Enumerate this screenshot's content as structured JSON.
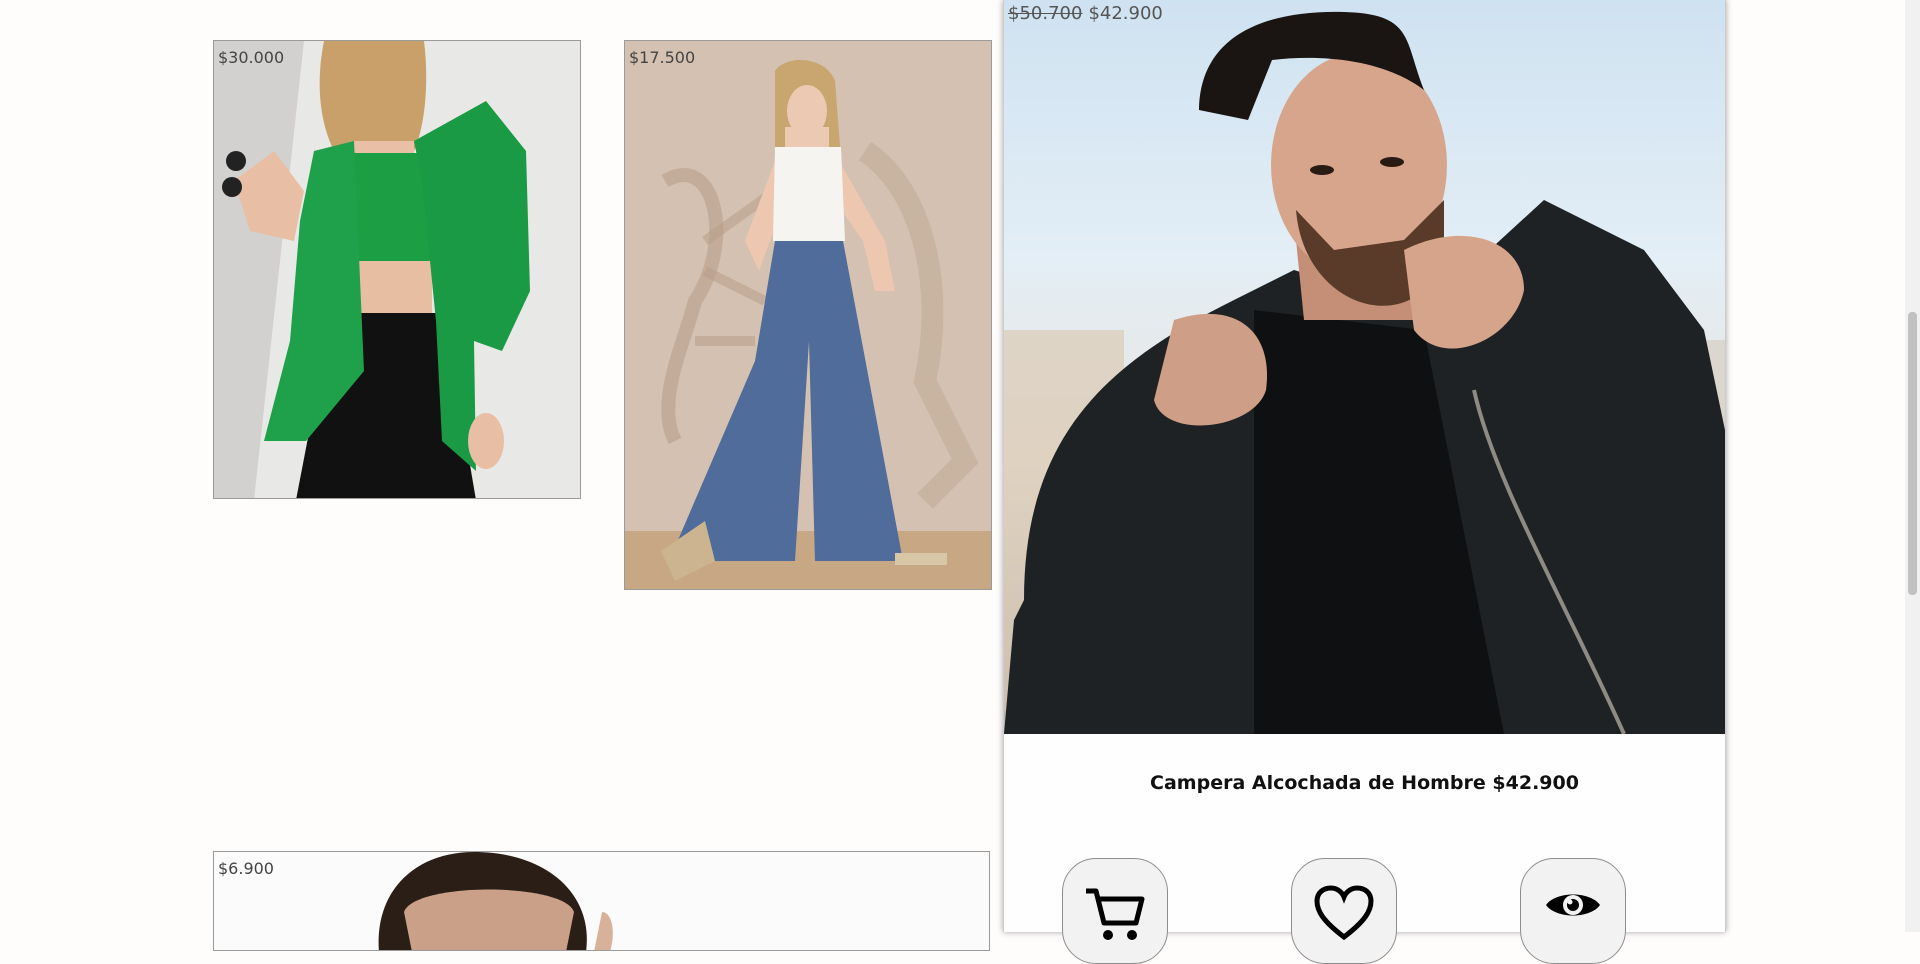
{
  "products": [
    {
      "id": "blazer",
      "price": "$30.000"
    },
    {
      "id": "jeans",
      "price": "$17.500"
    },
    {
      "id": "shirt",
      "price": "$6.900"
    }
  ],
  "detail": {
    "old_price": "$50.700",
    "price": "$42.900",
    "caption": "Campera Alcochada de Hombre $42.900",
    "actions": [
      {
        "id": "cart",
        "icon": "cart-icon"
      },
      {
        "id": "favorite",
        "icon": "heart-icon"
      },
      {
        "id": "view",
        "icon": "eye-icon"
      }
    ]
  },
  "colors": {
    "background": "#fffcfc",
    "card_border": "#9a9a9a",
    "button_bg": "#f2f2f2",
    "caption_text": "#111111"
  }
}
